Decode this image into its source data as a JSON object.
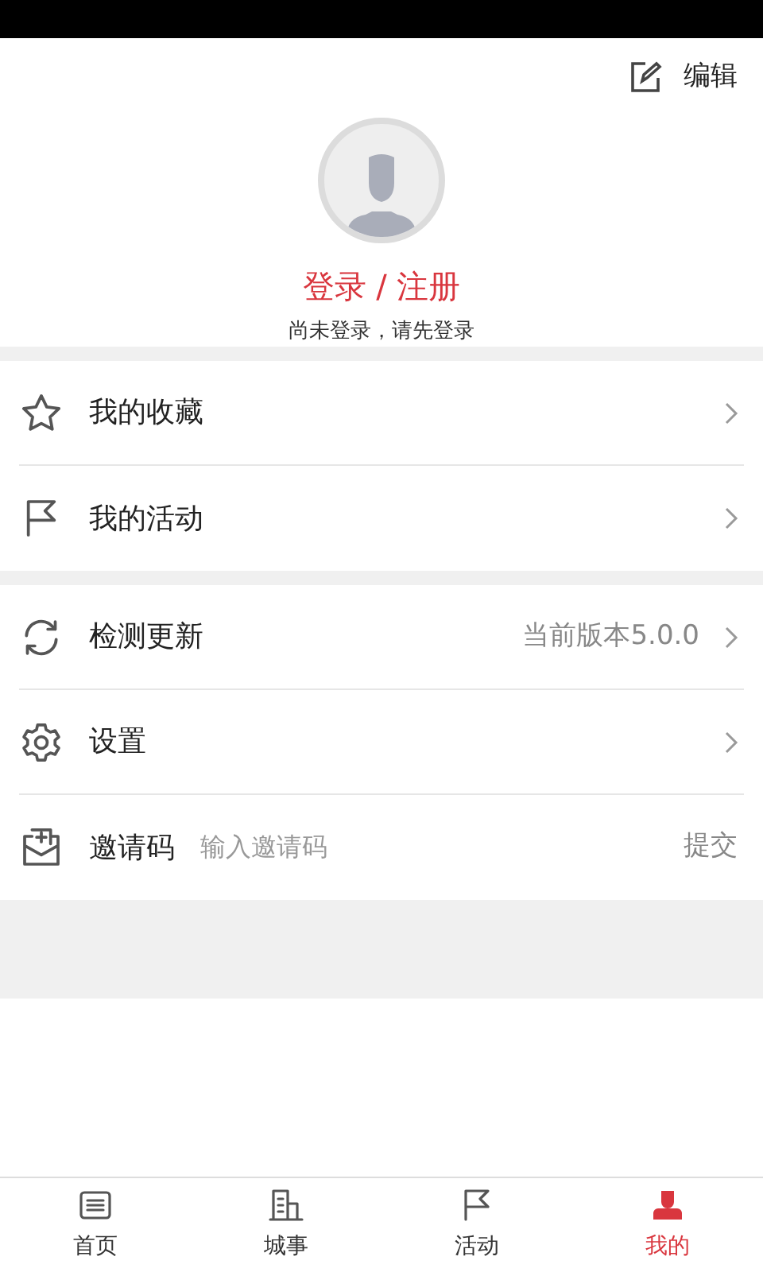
{
  "header": {
    "edit_label": "编辑",
    "login_label": "登录 / 注册",
    "login_hint": "尚未登录，请先登录"
  },
  "groups": [
    {
      "items": [
        {
          "kind": "link",
          "label": "我的收藏"
        },
        {
          "kind": "link",
          "label": "我的活动"
        }
      ]
    },
    {
      "items": [
        {
          "kind": "link",
          "label": "检测更新",
          "value": "当前版本5.0.0"
        },
        {
          "kind": "link",
          "label": "设置"
        },
        {
          "kind": "invite",
          "label": "邀请码",
          "placeholder": "输入邀请码",
          "action": "提交"
        }
      ]
    }
  ],
  "tabs": [
    {
      "label": "首页",
      "selected": false
    },
    {
      "label": "城事",
      "selected": false
    },
    {
      "label": "活动",
      "selected": false
    },
    {
      "label": "我的",
      "selected": true
    }
  ]
}
